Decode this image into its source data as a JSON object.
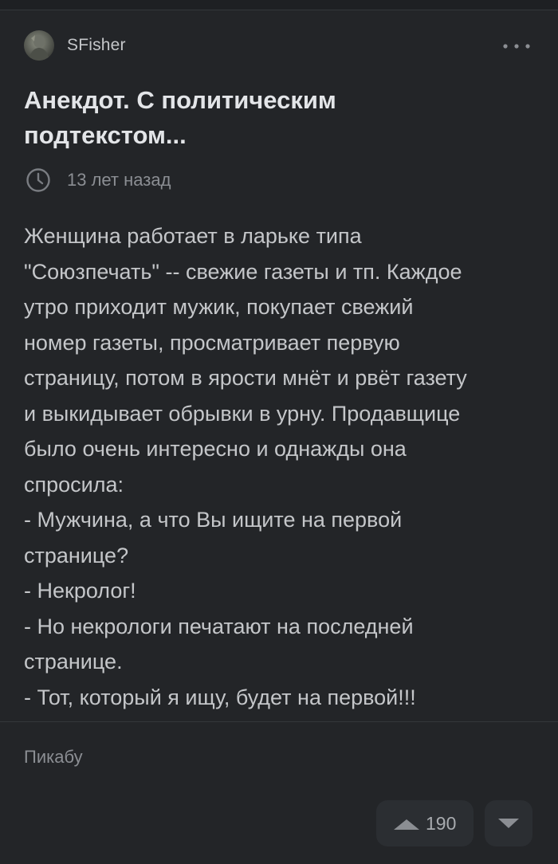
{
  "post": {
    "author": "SFisher",
    "title_line1": "Анекдот. С политическим",
    "title_line2": "подтекстом...",
    "time": "13 лет назад",
    "body_lines": [
      "Женщина работает в ларьке типа",
      "\"Союзпечать\" -- свежие газеты и тп. Каждое",
      "утро приходит мужик, покупает свежий",
      "номер газеты, просматривает первую",
      "страницу, потом в ярости мнёт и рвёт газету",
      "и выкидывает обрывки в урну. Продавщице",
      "было очень интересно и однажды она",
      "спросила:",
      "- Мужчина, а что Вы ищите на первой",
      "странице?",
      "- Некролог!",
      "- Но некрологи печатают на последней",
      "странице.",
      "- Тот, который я ищу, будет на первой!!!"
    ],
    "community": "Пикабу",
    "rating": "190"
  },
  "icons": {
    "avatar": "avatar-image",
    "more": "more-options-icon",
    "clock": "clock-icon",
    "vote_up": "triangle-up-icon",
    "vote_down": "triangle-down-icon"
  },
  "colors": {
    "background": "#232528",
    "title": "#e3e5e8",
    "text": "#c4c6c9",
    "muted": "#8b8e93",
    "button_bg": "#2b2e32"
  }
}
